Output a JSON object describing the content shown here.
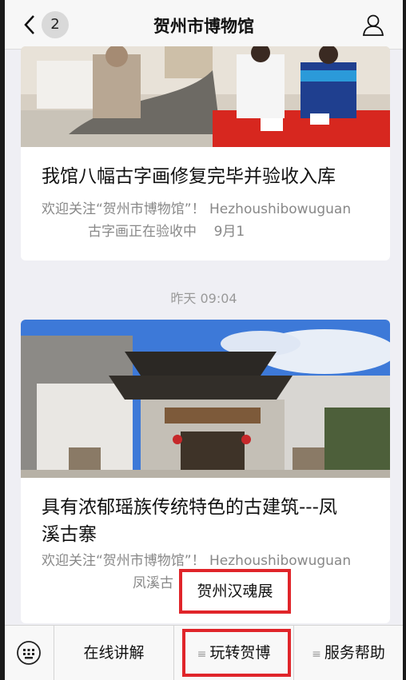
{
  "header": {
    "title": "贺州市博物馆",
    "unread_count": "2",
    "back_icon": "chevron-left-icon",
    "profile_icon": "user-icon"
  },
  "articles": [
    {
      "title": "我馆八幅古字画修复完毕并验收入库",
      "desc_line1": "欢迎关注“贺州市博物馆”！ Hezhoushibowuguan",
      "desc_line2": "古字画正在验收中    9月1"
    },
    {
      "title_line1": "具有浓郁瑶族传统特色的古建筑---凤",
      "title_line2": "溪古寨",
      "desc_line1": "欢迎关注“贺州市博物馆”！ Hezhoushibowuguan",
      "desc_line2": "凤溪古"
    }
  ],
  "timestamp": "昨天 09:04",
  "popup_menu": {
    "items": [
      "贺州汉魂展"
    ]
  },
  "bottom_menu": {
    "keyboard_icon": "keyboard-icon",
    "items": [
      "在线讲解",
      "玩转贺博",
      "服务帮助"
    ],
    "submenu_marker": "≡"
  },
  "colors": {
    "highlight": "#e0252a",
    "text_muted": "#888888",
    "background": "#efeff4"
  }
}
